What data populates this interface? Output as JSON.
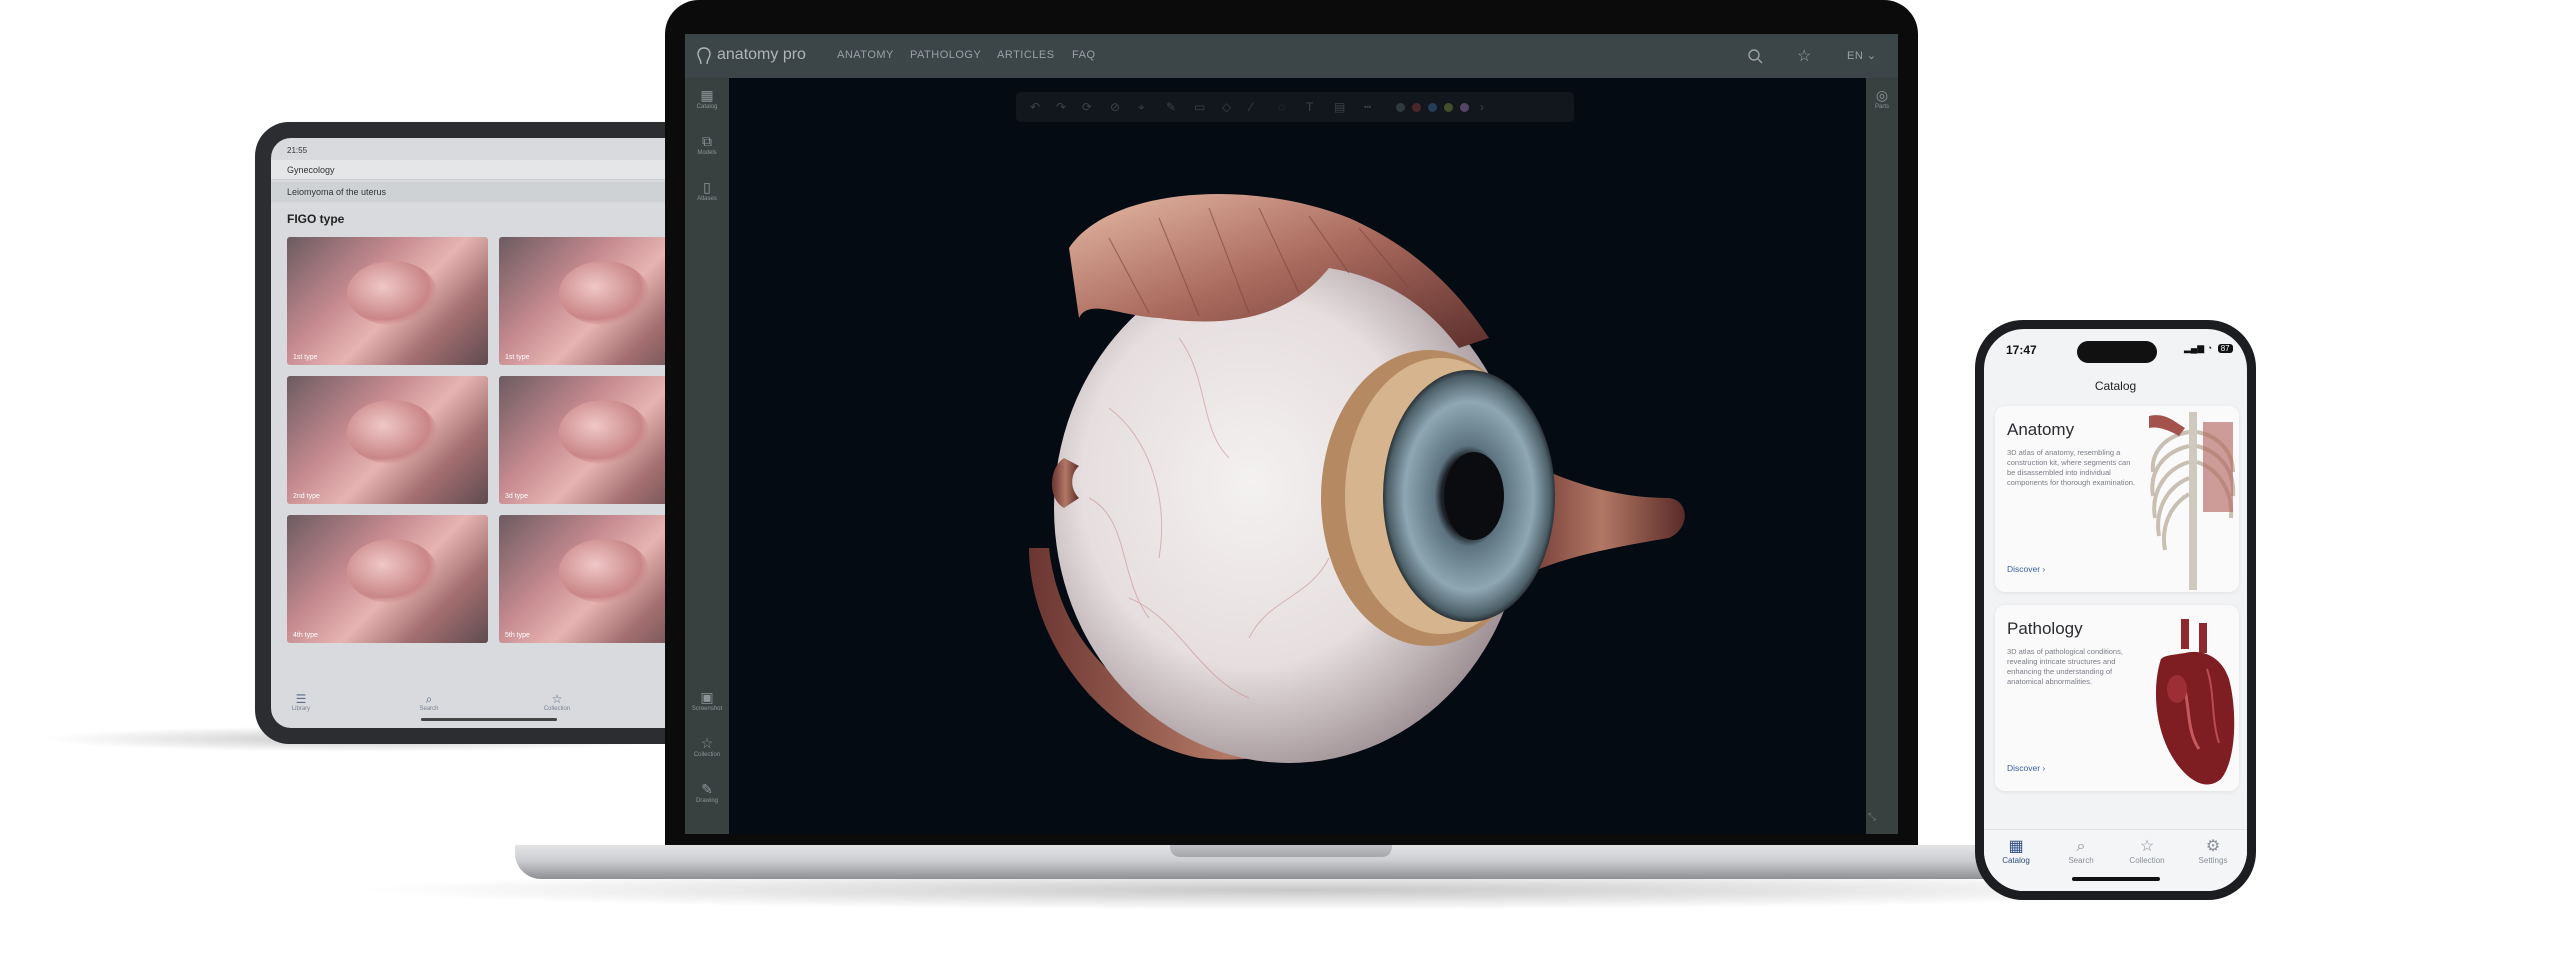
{
  "tablet": {
    "status_time": "21:55",
    "breadcrumb_1": "Gynecology",
    "breadcrumb_2": "Leiomyoma of the uterus",
    "heading": "FIGO type",
    "cards": [
      {
        "label": "1st type"
      },
      {
        "label": "1st type"
      },
      {
        "label": "2nd type"
      },
      {
        "label": "3d type"
      },
      {
        "label": "4th type"
      },
      {
        "label": "5th type"
      }
    ],
    "tabs": [
      {
        "label": "Library",
        "icon": "list-icon"
      },
      {
        "label": "Search",
        "icon": "search-icon"
      },
      {
        "label": "Collection",
        "icon": "star-icon"
      }
    ]
  },
  "laptop": {
    "logo": "anatomy pro",
    "nav": [
      "ANATOMY",
      "PATHOLOGY",
      "ARTICLES",
      "FAQ"
    ],
    "language": "EN",
    "sidebar_top": [
      {
        "label": "Catalog",
        "icon": "grid-icon"
      },
      {
        "label": "Models",
        "icon": "models-icon"
      },
      {
        "label": "Atlases",
        "icon": "book-icon"
      }
    ],
    "sidebar_bottom": [
      {
        "label": "Screenshot",
        "icon": "screenshot-icon"
      },
      {
        "label": "Collection",
        "icon": "star-icon"
      },
      {
        "label": "Drawing",
        "icon": "pencil-icon"
      }
    ],
    "right_panel": {
      "label": "Parts",
      "icon": "layers-icon"
    },
    "swatch_colors": [
      "#7a3b3b",
      "#3f5c8c",
      "#6c7d3a",
      "#8a6c9c"
    ]
  },
  "phone": {
    "time": "17:47",
    "battery": "87",
    "title": "Catalog",
    "cards": [
      {
        "title": "Anatomy",
        "description": "3D atlas of anatomy, resembling a construction kit, where segments can be disassembled into individual components for thorough examination.",
        "link": "Discover ›"
      },
      {
        "title": "Pathology",
        "description": "3D atlas of pathological conditions, revealing intricate structures and enhancing the understanding of anatomical abnormalities.",
        "link": "Discover ›"
      }
    ],
    "tabs": [
      {
        "label": "Catalog",
        "icon": "grid-icon",
        "active": true
      },
      {
        "label": "Search",
        "icon": "search-icon"
      },
      {
        "label": "Collection",
        "icon": "star-icon"
      },
      {
        "label": "Settings",
        "icon": "gear-icon"
      }
    ]
  },
  "colors": {
    "viewport_bg": "#040b12",
    "app_chrome": "#3c4548",
    "link_blue": "#3a5fa0"
  }
}
